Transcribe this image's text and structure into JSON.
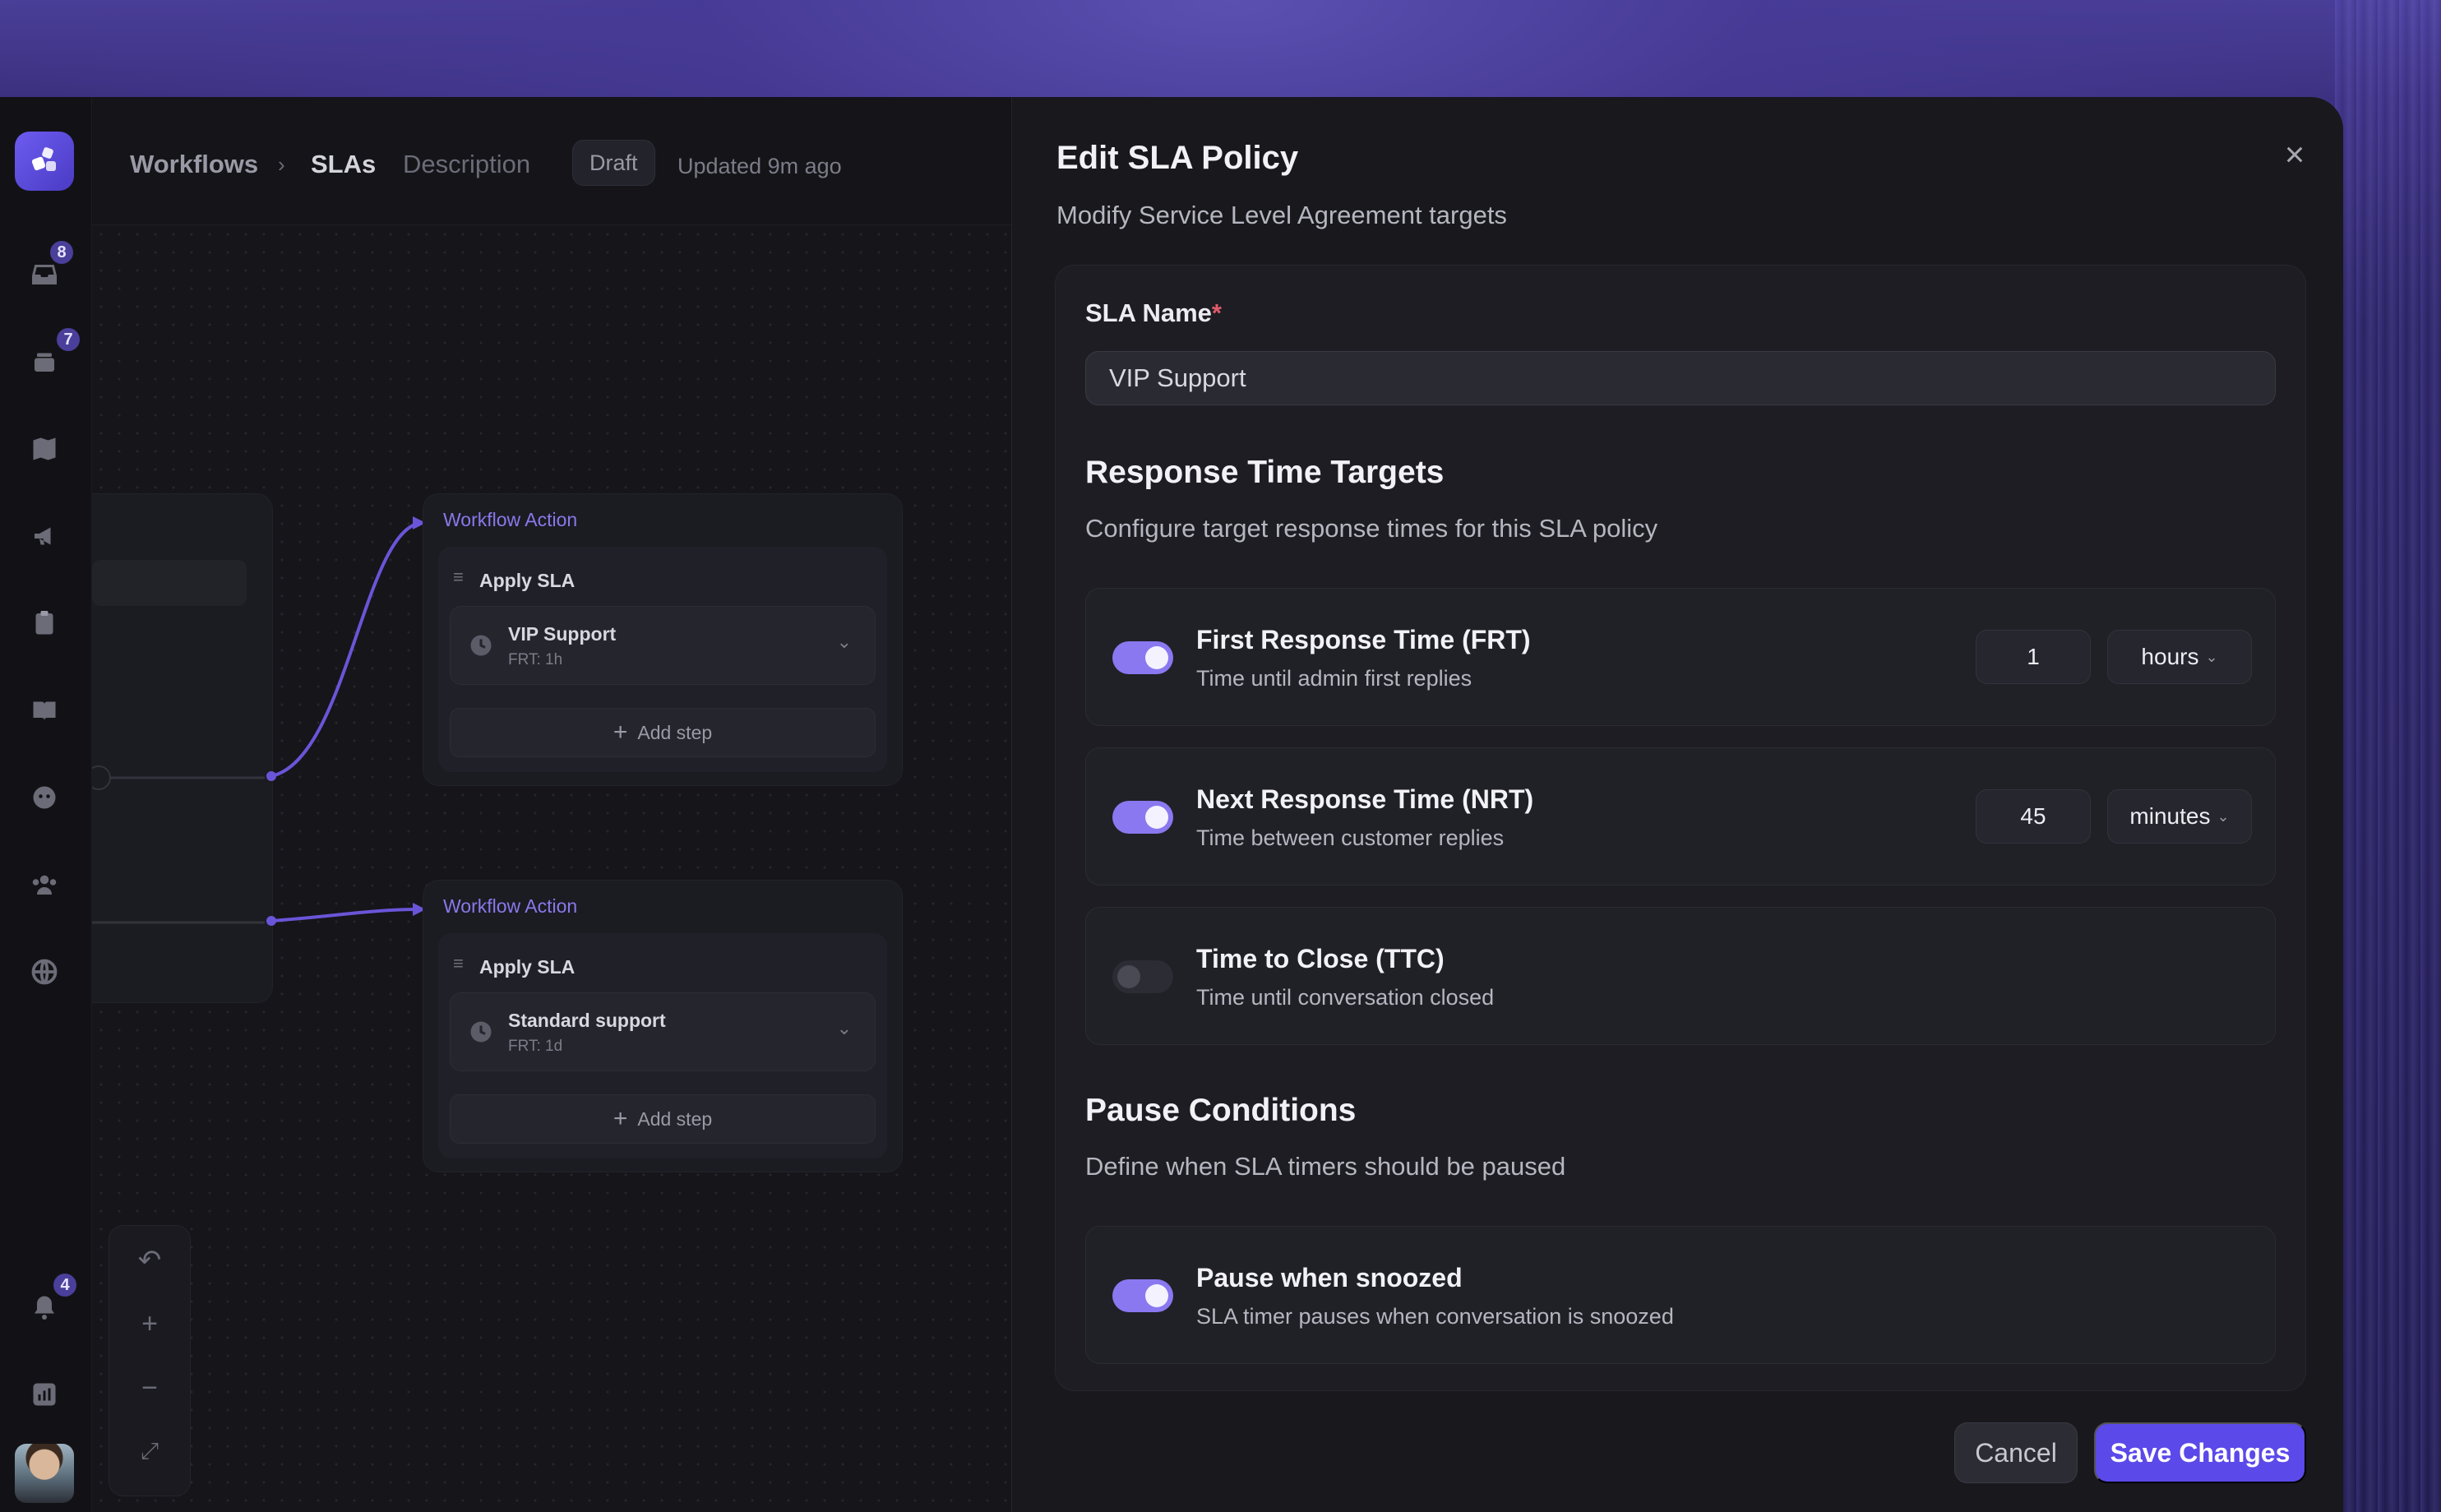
{
  "breadcrumb": {
    "root": "Workflows",
    "current": "SLAs",
    "description": "Description",
    "status": "Draft",
    "updated": "Updated 9m ago"
  },
  "rail": {
    "badges": {
      "inbox": "8",
      "tickets": "7",
      "notifications": "4"
    }
  },
  "canvas": {
    "nodes": [
      {
        "header": "Workflow Action",
        "step_title": "Apply SLA",
        "sla_name": "VIP Support",
        "sla_detail": "FRT: 1h",
        "add_step": "Add step"
      },
      {
        "header": "Workflow Action",
        "step_title": "Apply SLA",
        "sla_name": "Standard support",
        "sla_detail": "FRT: 1d",
        "add_step": "Add step"
      }
    ]
  },
  "modal": {
    "title": "Edit SLA Policy",
    "subtitle": "Modify Service Level Agreement targets",
    "sla_name_label": "SLA Name",
    "required_mark": "*",
    "sla_name_value": "VIP Support",
    "response_section": {
      "title": "Response Time Targets",
      "subtitle": "Configure target response times for this SLA policy"
    },
    "targets": [
      {
        "title": "First Response Time (FRT)",
        "subtitle": "Time until admin first replies",
        "enabled": true,
        "value": "1",
        "unit": "hours"
      },
      {
        "title": "Next Response Time (NRT)",
        "subtitle": "Time between customer replies",
        "enabled": true,
        "value": "45",
        "unit": "minutes"
      },
      {
        "title": "Time to Close (TTC)",
        "subtitle": "Time until conversation closed",
        "enabled": false
      }
    ],
    "pause_section": {
      "title": "Pause Conditions",
      "subtitle": "Define when SLA timers should be paused"
    },
    "pause_conditions": [
      {
        "title": "Pause when snoozed",
        "subtitle": "SLA timer pauses when conversation is snoozed",
        "enabled": true
      }
    ],
    "cancel_label": "Cancel",
    "save_label": "Save Changes"
  },
  "colors": {
    "accent": "#5b49ea",
    "toggle_on": "#8a78f0",
    "node_header": "#8a78ea",
    "required": "#e05a6a"
  }
}
